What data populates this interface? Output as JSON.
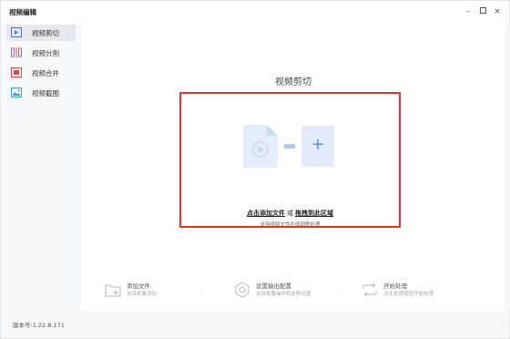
{
  "window": {
    "title": "视频编辑",
    "controls": {
      "minimize": "–",
      "close": "×"
    }
  },
  "sidebar": {
    "items": [
      {
        "label": "视频剪切",
        "icon": "clip-icon",
        "active": true,
        "color": "#4a78d0"
      },
      {
        "label": "视频分割",
        "icon": "split-icon",
        "active": false,
        "color": "#a35bd1"
      },
      {
        "label": "视频合并",
        "icon": "merge-icon",
        "active": false,
        "color": "#e14b3b"
      },
      {
        "label": "视频截图",
        "icon": "screenshot-icon",
        "active": false,
        "color": "#3c9bd6"
      }
    ]
  },
  "version": "版本号:1.22.8.171",
  "main": {
    "title": "视频剪切",
    "dropzone": {
      "add_file": "点击添加文件",
      "or": "或",
      "drag_here": "拖拽到此区域",
      "hint": "支持视频文件在线调整处理",
      "highlight_color": "#e0332b"
    },
    "steps": [
      {
        "title": "添加文件",
        "subtitle": "支持批量添加",
        "icon": "add-file-icon"
      },
      {
        "title": "设置输出配置",
        "subtitle": "支持批量操作和各种设置",
        "icon": "settings-icon"
      },
      {
        "title": "开始处理",
        "subtitle": "点击处理按钮开始处理",
        "icon": "process-icon"
      }
    ],
    "arrow": "›"
  }
}
